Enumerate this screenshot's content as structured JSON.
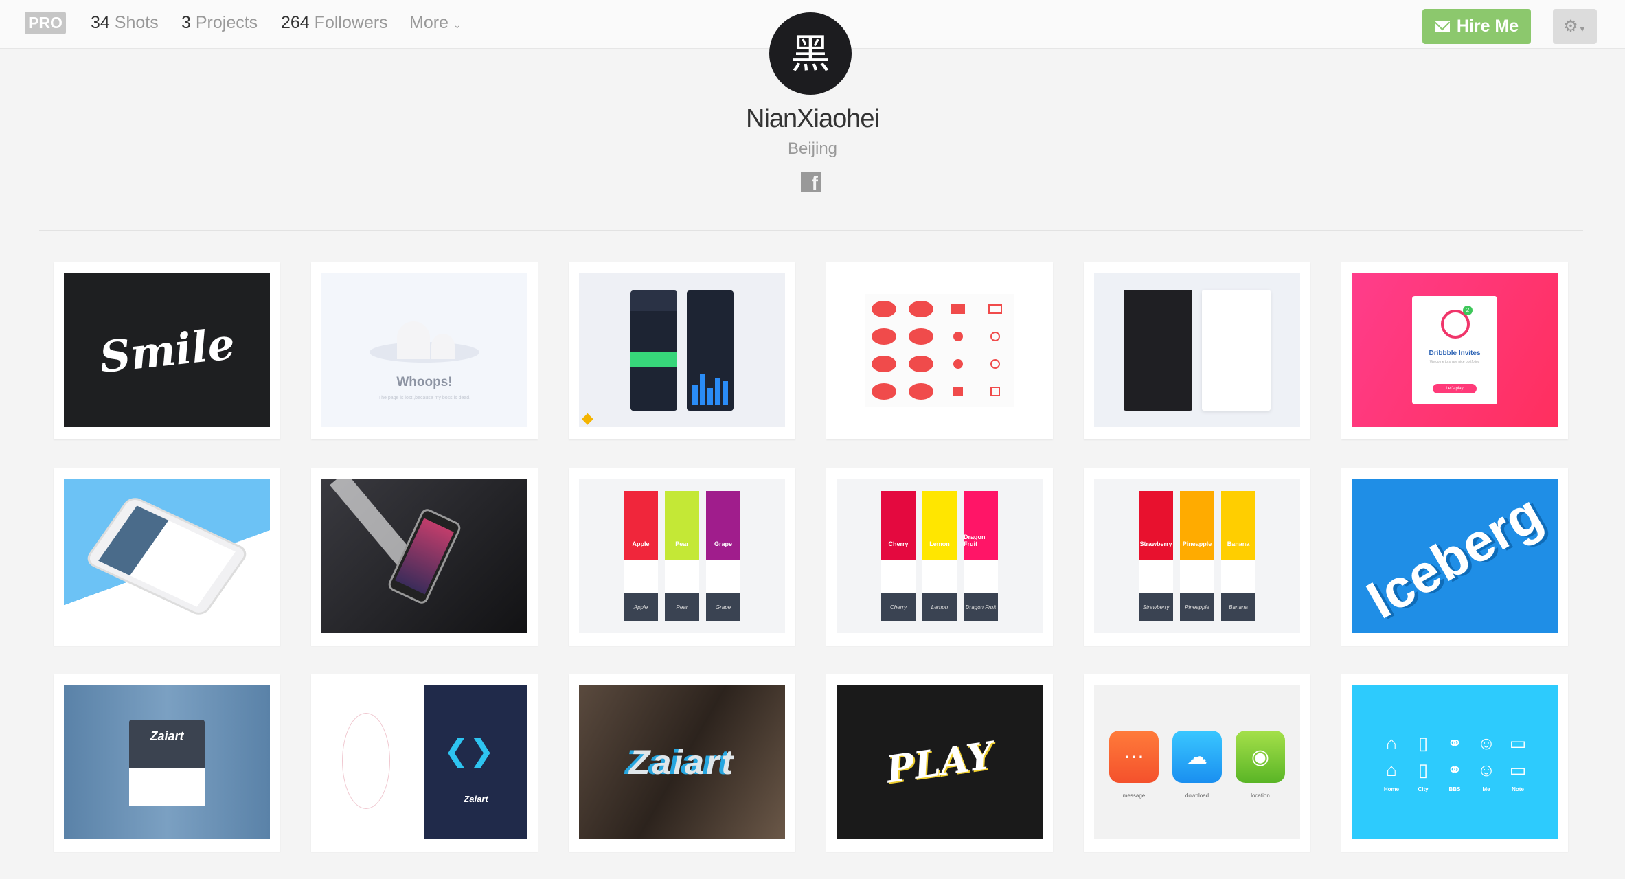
{
  "header": {
    "pro_badge": "PRO",
    "stats": [
      {
        "count": "34",
        "label": "Shots"
      },
      {
        "count": "3",
        "label": "Projects"
      },
      {
        "count": "264",
        "label": "Followers"
      }
    ],
    "more_label": "More",
    "hire_label": "Hire Me",
    "accent_color": "#8cc86d"
  },
  "profile": {
    "avatar_char": "黑",
    "name": "NianXiaohei",
    "location": "Beijing",
    "social": "facebook"
  },
  "shots": {
    "smile": "Smile",
    "whoops_title": "Whoops!",
    "whoops_sub": "The page is lost ,because my boss is dead.",
    "invite_title": "Dribbble Invites",
    "invite_sub": "Welcome to share nice portfolios",
    "invite_btn": "Let's play",
    "invite_badge": "2",
    "fruits1": [
      "Apple",
      "Pear",
      "Grape"
    ],
    "fruits2": [
      "Cherry",
      "Lemon",
      "Dragon Fruit"
    ],
    "fruits3": [
      "Strawberry",
      "Pineapple",
      "Banana"
    ],
    "iceberg": "Iceberg",
    "zaiart": "Zaiart",
    "play": "PLAY",
    "apps": [
      "message",
      "download",
      "location"
    ],
    "nav_icons": [
      "Home",
      "City",
      "BBS",
      "Me",
      "Note"
    ]
  }
}
